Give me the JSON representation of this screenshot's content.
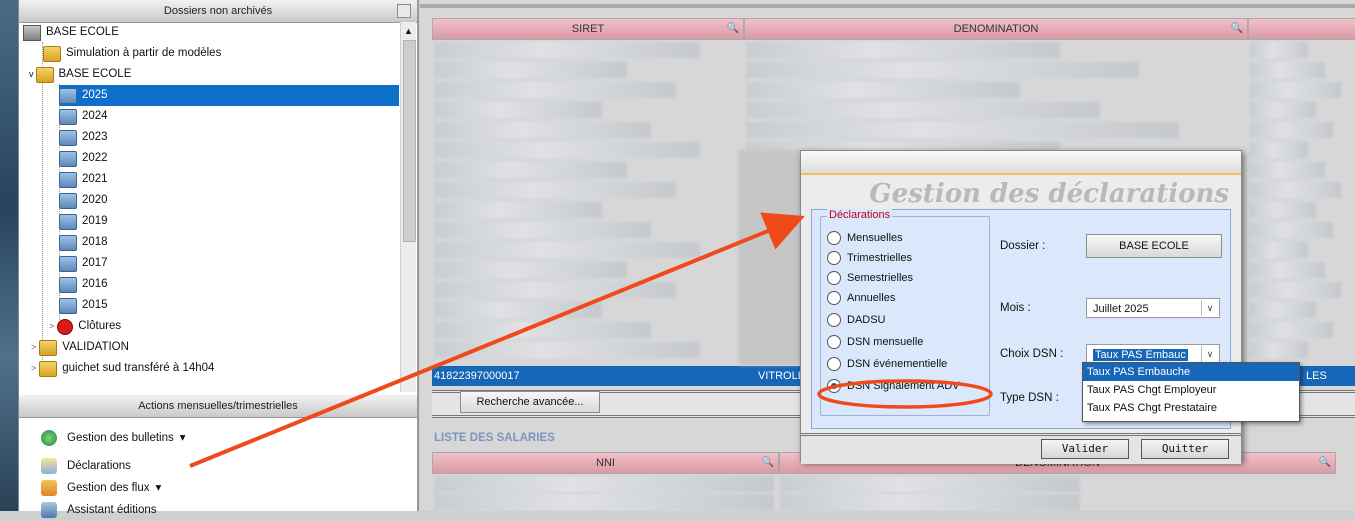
{
  "tree_panel": {
    "header": "Dossiers non archivés",
    "root": "BASE ECOLE",
    "items": [
      {
        "label": "Simulation à partir de modèles"
      },
      {
        "label": "BASE ECOLE"
      },
      {
        "label": "2025"
      },
      {
        "label": "2024"
      },
      {
        "label": "2023"
      },
      {
        "label": "2022"
      },
      {
        "label": "2021"
      },
      {
        "label": "2020"
      },
      {
        "label": "2019"
      },
      {
        "label": "2018"
      },
      {
        "label": "2017"
      },
      {
        "label": "2016"
      },
      {
        "label": "2015"
      },
      {
        "label": "Clôtures"
      },
      {
        "label": "VALIDATION"
      },
      {
        "label": "guichet sud transféré à 14h04"
      }
    ]
  },
  "actions_panel": {
    "header": "Actions mensuelles/trimestrielles",
    "items": [
      {
        "label": "Gestion des bulletins",
        "caret": "▾"
      },
      {
        "label": "Déclarations"
      },
      {
        "label": "Gestion des flux",
        "caret": "▾"
      },
      {
        "label": "Assistant éditions"
      }
    ]
  },
  "companies_table": {
    "columns": [
      "SIRET",
      "DENOMINATION"
    ],
    "selected_row": {
      "siret": "41822397000017",
      "denomination": "VITROLL",
      "extra": "LES"
    },
    "advanced_search": "Recherche avancée..."
  },
  "employees": {
    "section_title": "LISTE DES SALARIES",
    "columns": [
      "NNI",
      "DENOMINATION"
    ]
  },
  "dialog": {
    "title": "Gestion des déclarations",
    "group_label": "Déclarations",
    "radios": [
      {
        "label": "Mensuelles",
        "checked": false
      },
      {
        "label": "Trimestrielles",
        "checked": false
      },
      {
        "label": "Semestrielles",
        "checked": false
      },
      {
        "label": "Annuelles",
        "checked": false
      },
      {
        "label": "DADSU",
        "checked": false
      },
      {
        "label": "DSN mensuelle",
        "checked": false
      },
      {
        "label": "DSN événementielle",
        "checked": false
      },
      {
        "label": "DSN Signalement ADV",
        "checked": true
      }
    ],
    "dossier_label": "Dossier :",
    "dossier_value": "BASE ECOLE",
    "mois_label": "Mois :",
    "mois_value": "Juillet 2025",
    "choix_label": "Choix DSN :",
    "choix_value": "Taux PAS Embauc",
    "type_label": "Type DSN :",
    "choix_options": [
      "Taux PAS Embauche",
      "Taux PAS Chgt Employeur",
      "Taux PAS Chgt Prestataire"
    ],
    "valider": "Valider",
    "quitter": "Quitter"
  },
  "colors": {
    "selection": "#0e6fc9",
    "annotation": "#f04a1a",
    "header_pink": "#e3aab4"
  }
}
